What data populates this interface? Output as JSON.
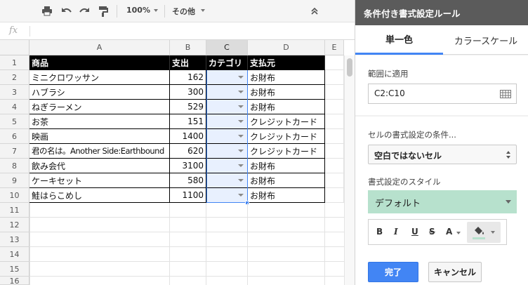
{
  "toolbar": {
    "zoom": "100%",
    "more": "その他"
  },
  "formula_bar": {
    "fx": "fx",
    "value": ""
  },
  "sheet": {
    "columns": [
      "A",
      "B",
      "C",
      "D",
      "E"
    ],
    "selected_column": "C",
    "rows": [
      "1",
      "2",
      "3",
      "4",
      "5",
      "6",
      "7",
      "8",
      "9",
      "10",
      "11",
      "12",
      "13",
      "14",
      "15",
      "16"
    ],
    "header": [
      "商品",
      "支出",
      "カテゴリ",
      "支払元"
    ],
    "data": [
      [
        "ミニクロワッサン",
        "162",
        "",
        "お財布"
      ],
      [
        "ハブラシ",
        "300",
        "",
        "お財布"
      ],
      [
        "ねぎラーメン",
        "529",
        "",
        "お財布"
      ],
      [
        "お茶",
        "151",
        "",
        "クレジットカード"
      ],
      [
        "映画",
        "1400",
        "",
        "クレジットカード"
      ],
      [
        "君の名は。Another Side:Earthbound",
        "620",
        "",
        "クレジットカード"
      ],
      [
        "飲み会代",
        "3100",
        "",
        "お財布"
      ],
      [
        "ケーキセット",
        "580",
        "",
        "お財布"
      ],
      [
        "鮭はらこめし",
        "1100",
        "",
        "お財布"
      ]
    ]
  },
  "panel": {
    "title": "条件付き書式設定ルール",
    "tabs": [
      "単一色",
      "カラースケール"
    ],
    "active_tab": "単一色",
    "range_label": "範囲に適用",
    "range_value": "C2:C10",
    "condition_label": "セルの書式設定の条件...",
    "condition_value": "空白ではないセル",
    "style_label": "書式設定のスタイル",
    "style_value": "デフォルト",
    "style_color": "#b7e1cd",
    "format_buttons": {
      "bold": "B",
      "italic": "I",
      "underline": "U",
      "strikethrough": "S",
      "text_color": "A"
    },
    "done_label": "完了",
    "cancel_label": "キャンセル"
  },
  "colors": {
    "accent": "#4285f4",
    "header_bg": "#5b5b5b",
    "table_header": "#000000",
    "selection": "#e8f0fe"
  }
}
